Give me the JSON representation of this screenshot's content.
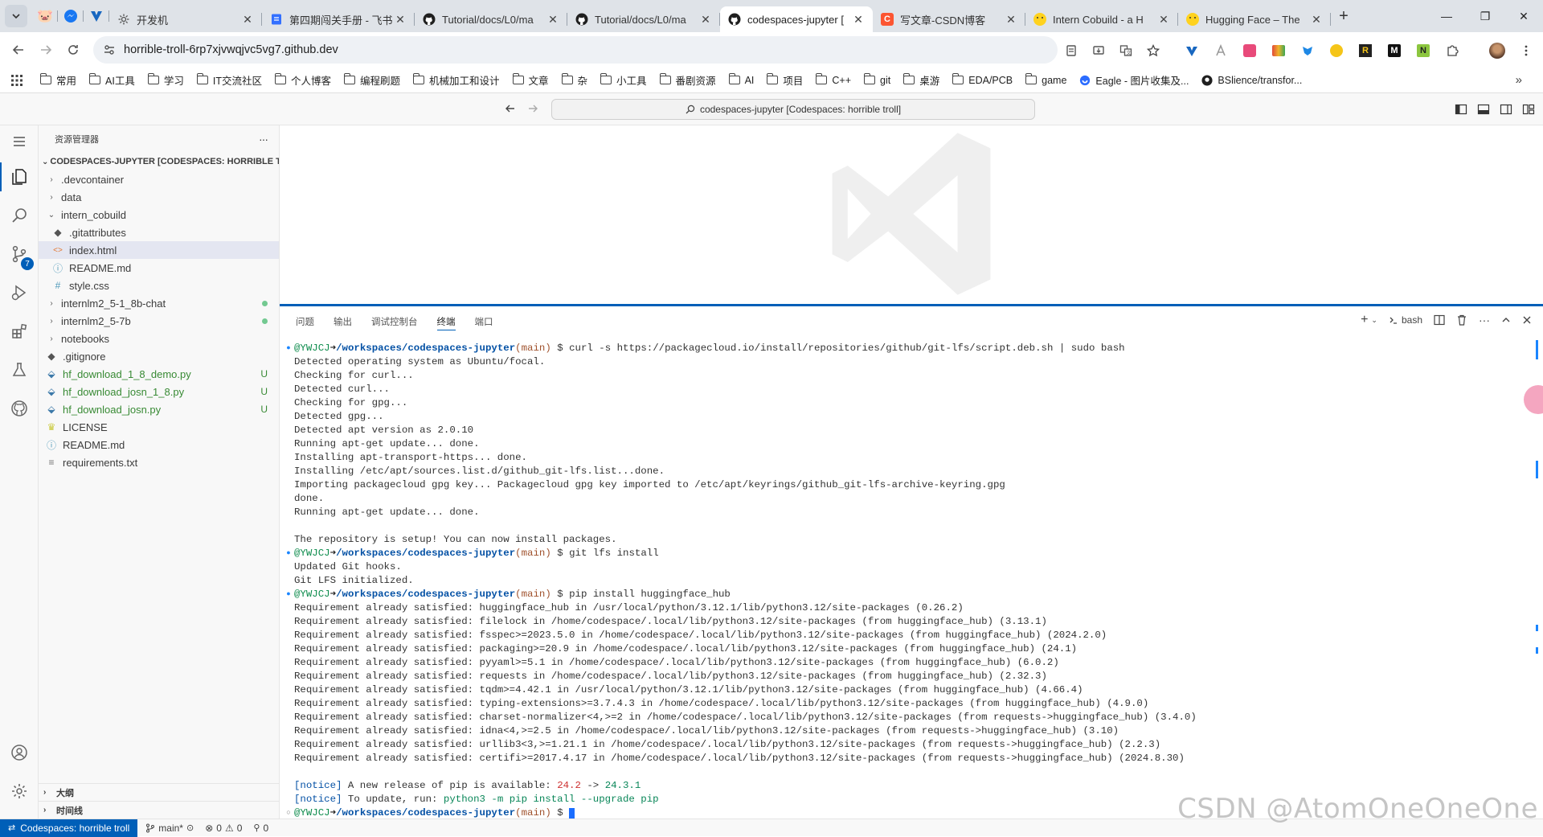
{
  "browser": {
    "tabs": [
      {
        "title": "开发机",
        "icon": "gear-icon"
      },
      {
        "title": "第四期闯关手册 - 飞书",
        "icon": "doc-icon"
      },
      {
        "title": "Tutorial/docs/L0/ma",
        "icon": "github-icon"
      },
      {
        "title": "Tutorial/docs/L0/ma",
        "icon": "github-icon"
      },
      {
        "title": "codespaces-jupyter [",
        "icon": "github-icon",
        "active": true
      },
      {
        "title": "写文章-CSDN博客",
        "icon": "csdn-icon"
      },
      {
        "title": "Intern Cobuild - a H",
        "icon": "huggingface-icon"
      },
      {
        "title": "Hugging Face – The",
        "icon": "huggingface-icon"
      }
    ],
    "new_tab": "+",
    "url": "horrible-troll-6rp7xjvwqjvc5vg7.github.dev",
    "bookmarks": [
      {
        "label": "常用",
        "folder": true
      },
      {
        "label": "AI工具",
        "folder": true
      },
      {
        "label": "学习",
        "folder": true
      },
      {
        "label": "IT交流社区",
        "folder": true
      },
      {
        "label": "个人博客",
        "folder": true
      },
      {
        "label": "编程刷题",
        "folder": true
      },
      {
        "label": "机械加工和设计",
        "folder": true
      },
      {
        "label": "文章",
        "folder": true
      },
      {
        "label": "杂",
        "folder": true
      },
      {
        "label": "小工具",
        "folder": true
      },
      {
        "label": "番剧资源",
        "folder": true
      },
      {
        "label": "AI",
        "folder": true
      },
      {
        "label": "项目",
        "folder": true
      },
      {
        "label": "C++",
        "folder": true
      },
      {
        "label": "git",
        "folder": true
      },
      {
        "label": "桌游",
        "folder": true
      },
      {
        "label": "EDA/PCB",
        "folder": true
      },
      {
        "label": "game",
        "folder": true
      },
      {
        "label": "Eagle - 图片收集及...",
        "folder": false
      },
      {
        "label": "BSlience/transfor...",
        "folder": false
      }
    ],
    "bookmarks_more": "»"
  },
  "vscode": {
    "command_center": "codespaces-jupyter [Codespaces: horrible troll]",
    "scm_badge": "7",
    "explorer": {
      "header": "资源管理器",
      "more": "···",
      "root": "CODESPACES-JUPYTER [CODESPACES: HORRIBLE TR...",
      "items": [
        {
          "label": ".devcontainer",
          "type": "folder",
          "depth": 1,
          "expanded": false
        },
        {
          "label": "data",
          "type": "folder",
          "depth": 1,
          "expanded": false
        },
        {
          "label": "intern_cobuild",
          "type": "folder",
          "depth": 1,
          "expanded": true
        },
        {
          "label": ".gitattributes",
          "type": "git",
          "depth": 2
        },
        {
          "label": "index.html",
          "type": "html",
          "depth": 2,
          "selected": true
        },
        {
          "label": "README.md",
          "type": "info",
          "depth": 2
        },
        {
          "label": "style.css",
          "type": "css",
          "depth": 2
        },
        {
          "label": "internlm2_5-1_8b-chat",
          "type": "folder",
          "depth": 1,
          "expanded": false,
          "status": "dot"
        },
        {
          "label": "internlm2_5-7b",
          "type": "folder",
          "depth": 1,
          "expanded": false,
          "status": "dot"
        },
        {
          "label": "notebooks",
          "type": "folder",
          "depth": 1,
          "expanded": false
        },
        {
          "label": ".gitignore",
          "type": "git",
          "depth": 1
        },
        {
          "label": "hf_download_1_8_demo.py",
          "type": "py",
          "depth": 1,
          "status": "U",
          "untracked": true
        },
        {
          "label": "hf_download_josn_1_8.py",
          "type": "py",
          "depth": 1,
          "status": "U",
          "untracked": true
        },
        {
          "label": "hf_download_josn.py",
          "type": "py",
          "depth": 1,
          "status": "U",
          "untracked": true
        },
        {
          "label": "LICENSE",
          "type": "license",
          "depth": 1
        },
        {
          "label": "README.md",
          "type": "info",
          "depth": 1
        },
        {
          "label": "requirements.txt",
          "type": "txt",
          "depth": 1
        }
      ],
      "outline": "大纲",
      "timeline": "时间线"
    },
    "panel": {
      "tabs": [
        "问题",
        "输出",
        "调试控制台",
        "终端",
        "端口"
      ],
      "active_tab": "终端",
      "shell": "bash"
    },
    "status": {
      "remote": "Codespaces: horrible troll",
      "branch": "main*",
      "errors": "0",
      "warnings": "0",
      "ports": "0"
    }
  },
  "terminal": {
    "user": "@YWJCJ",
    "arrow": "➜",
    "path": "/workspaces/codespaces-jupyter",
    "branch": "(main)",
    "lines": [
      {
        "kind": "prompt",
        "cmd": "curl -s https://packagecloud.io/install/repositories/github/git-lfs/script.deb.sh | sudo bash"
      },
      {
        "kind": "out",
        "text": "Detected operating system as Ubuntu/focal."
      },
      {
        "kind": "out",
        "text": "Checking for curl..."
      },
      {
        "kind": "out",
        "text": "Detected curl..."
      },
      {
        "kind": "out",
        "text": "Checking for gpg..."
      },
      {
        "kind": "out",
        "text": "Detected gpg..."
      },
      {
        "kind": "out",
        "text": "Detected apt version as 2.0.10"
      },
      {
        "kind": "out",
        "text": "Running apt-get update... done."
      },
      {
        "kind": "out",
        "text": "Installing apt-transport-https... done."
      },
      {
        "kind": "out",
        "text": "Installing /etc/apt/sources.list.d/github_git-lfs.list...done."
      },
      {
        "kind": "out",
        "text": "Importing packagecloud gpg key... Packagecloud gpg key imported to /etc/apt/keyrings/github_git-lfs-archive-keyring.gpg"
      },
      {
        "kind": "out",
        "text": "done."
      },
      {
        "kind": "out",
        "text": "Running apt-get update... done."
      },
      {
        "kind": "out",
        "text": ""
      },
      {
        "kind": "out",
        "text": "The repository is setup! You can now install packages."
      },
      {
        "kind": "prompt",
        "cmd": "git lfs install"
      },
      {
        "kind": "out",
        "text": "Updated Git hooks."
      },
      {
        "kind": "out",
        "text": "Git LFS initialized."
      },
      {
        "kind": "prompt",
        "cmd": "pip install huggingface_hub"
      },
      {
        "kind": "out",
        "text": "Requirement already satisfied: huggingface_hub in /usr/local/python/3.12.1/lib/python3.12/site-packages (0.26.2)"
      },
      {
        "kind": "out",
        "text": "Requirement already satisfied: filelock in /home/codespace/.local/lib/python3.12/site-packages (from huggingface_hub) (3.13.1)"
      },
      {
        "kind": "out",
        "text": "Requirement already satisfied: fsspec>=2023.5.0 in /home/codespace/.local/lib/python3.12/site-packages (from huggingface_hub) (2024.2.0)"
      },
      {
        "kind": "out",
        "text": "Requirement already satisfied: packaging>=20.9 in /home/codespace/.local/lib/python3.12/site-packages (from huggingface_hub) (24.1)"
      },
      {
        "kind": "out",
        "text": "Requirement already satisfied: pyyaml>=5.1 in /home/codespace/.local/lib/python3.12/site-packages (from huggingface_hub) (6.0.2)"
      },
      {
        "kind": "out",
        "text": "Requirement already satisfied: requests in /home/codespace/.local/lib/python3.12/site-packages (from huggingface_hub) (2.32.3)"
      },
      {
        "kind": "out",
        "text": "Requirement already satisfied: tqdm>=4.42.1 in /usr/local/python/3.12.1/lib/python3.12/site-packages (from huggingface_hub) (4.66.4)"
      },
      {
        "kind": "out",
        "text": "Requirement already satisfied: typing-extensions>=3.7.4.3 in /home/codespace/.local/lib/python3.12/site-packages (from huggingface_hub) (4.9.0)"
      },
      {
        "kind": "out",
        "text": "Requirement already satisfied: charset-normalizer<4,>=2 in /home/codespace/.local/lib/python3.12/site-packages (from requests->huggingface_hub) (3.4.0)"
      },
      {
        "kind": "out",
        "text": "Requirement already satisfied: idna<4,>=2.5 in /home/codespace/.local/lib/python3.12/site-packages (from requests->huggingface_hub) (3.10)"
      },
      {
        "kind": "out",
        "text": "Requirement already satisfied: urllib3<3,>=1.21.1 in /home/codespace/.local/lib/python3.12/site-packages (from requests->huggingface_hub) (2.2.3)"
      },
      {
        "kind": "out",
        "text": "Requirement already satisfied: certifi>=2017.4.17 in /home/codespace/.local/lib/python3.12/site-packages (from requests->huggingface_hub) (2024.8.30)"
      },
      {
        "kind": "out",
        "text": ""
      },
      {
        "kind": "notice",
        "tag": "[notice]",
        "pre": " A new release of pip is available: ",
        "old": "24.2",
        "mid": " -> ",
        "new": "24.3.1"
      },
      {
        "kind": "notice2",
        "tag": "[notice]",
        "pre": " To update, run: ",
        "cmd": "python3 -m pip install --upgrade pip"
      },
      {
        "kind": "prompt_empty",
        "cmd": ""
      }
    ]
  },
  "watermark": "CSDN @AtomOneOneOne",
  "colors": {
    "accent": "#005fb8",
    "prompt_user": "#0a8a4a",
    "path": "#0451a5",
    "branch": "#a0522d",
    "untracked": "#73c991"
  }
}
